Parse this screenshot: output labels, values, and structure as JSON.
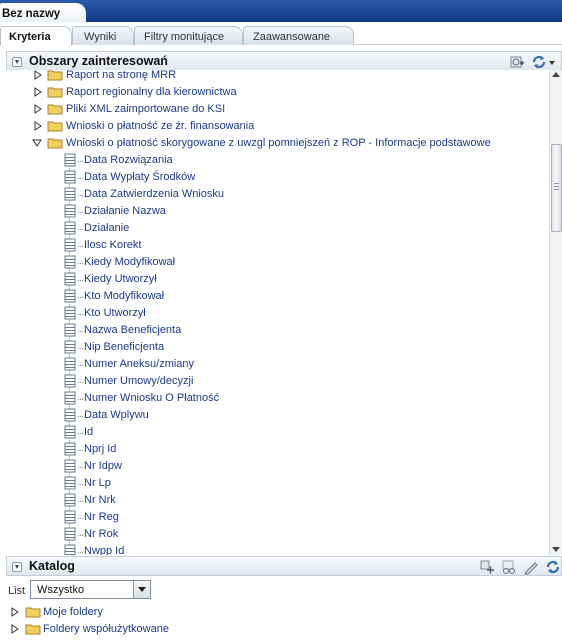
{
  "document_tab": "Bez nazwy",
  "tabs": [
    "Kryteria",
    "Wyniki",
    "Filtry monitujące",
    "Zaawansowane"
  ],
  "subject_areas": {
    "title": "Obszary zainteresowań",
    "tree": [
      {
        "label": "Raport na stronę MRR",
        "type": "folder",
        "expanded": false
      },
      {
        "label": "Raport regionalny dla kierownictwa",
        "type": "folder",
        "expanded": false
      },
      {
        "label": "Pliki XML zaimportowane do KSI",
        "type": "folder",
        "expanded": false
      },
      {
        "label": "Wnioski o płatność ze źr. finansowania",
        "type": "folder",
        "expanded": false
      },
      {
        "label": "Wnioski o płatność skorygowane z uwzgl pomniejszeń z ROP - Informacje podstawowe",
        "type": "folder",
        "expanded": true
      },
      {
        "label": "Data Rozwiązania",
        "type": "column"
      },
      {
        "label": "Data Wypłaty Środków",
        "type": "column"
      },
      {
        "label": "Data Zatwierdzenia Wniosku",
        "type": "column"
      },
      {
        "label": "Działanie Nazwa",
        "type": "column"
      },
      {
        "label": "Działanie",
        "type": "column"
      },
      {
        "label": "Ilosc Korekt",
        "type": "column"
      },
      {
        "label": "Kiedy Modyfikował",
        "type": "column"
      },
      {
        "label": "Kiedy Utworzył",
        "type": "column"
      },
      {
        "label": "Kto Modyfikował",
        "type": "column"
      },
      {
        "label": "Kto Utworzył",
        "type": "column"
      },
      {
        "label": "Nazwa Beneficjenta",
        "type": "column"
      },
      {
        "label": "Nip Beneficjenta",
        "type": "column"
      },
      {
        "label": "Numer Aneksu/zmiany",
        "type": "column"
      },
      {
        "label": "Numer Umowy/decyzji",
        "type": "column"
      },
      {
        "label": "Numer Wniosku O Płatność",
        "type": "column"
      },
      {
        "label": "Data Wplywu",
        "type": "column"
      },
      {
        "label": "Id",
        "type": "column"
      },
      {
        "label": "Nprj Id",
        "type": "column"
      },
      {
        "label": "Nr Idpw",
        "type": "column"
      },
      {
        "label": "Nr Lp",
        "type": "column"
      },
      {
        "label": "Nr Nrk",
        "type": "column"
      },
      {
        "label": "Nr Reg",
        "type": "column"
      },
      {
        "label": "Nr Rok",
        "type": "column"
      },
      {
        "label": "Nwpp Id",
        "type": "column"
      }
    ]
  },
  "catalog": {
    "title": "Katalog",
    "list_label": "List",
    "list_value": "Wszystko",
    "folders": [
      "Moje foldery",
      "Foldery współużytkowane"
    ]
  },
  "colors": {
    "header_blue": "#0d3b86",
    "link_blue": "#1b3a8a",
    "folder_yellow": "#f2d060"
  }
}
